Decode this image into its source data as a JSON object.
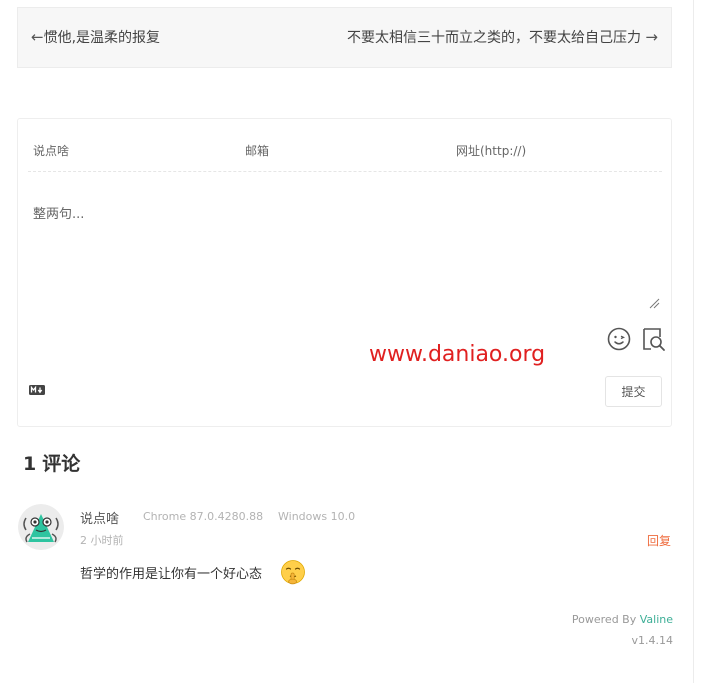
{
  "post_nav": {
    "prev_arrow": "←",
    "prev_title": "惯他,是温柔的报复",
    "next_title": "不要太相信三十而立之类的，不要太给自己压力",
    "next_arrow": "→"
  },
  "form": {
    "nick_placeholder": "说点啥",
    "mail_placeholder": "邮箱",
    "link_placeholder": "网址(http://)",
    "editor_placeholder": "整两句...",
    "submit_label": "提交",
    "icons": [
      "emoji-icon",
      "preview-icon",
      "markdown-icon",
      "resize-grip-icon"
    ]
  },
  "watermark": "www.daniao.org",
  "comments_header": {
    "count": "1",
    "label": "评论"
  },
  "comments": [
    {
      "nick": "说点啥",
      "browser": "Chrome 87.0.4280.88",
      "os": "Windows 10.0",
      "time": "2 小时前",
      "reply_label": "回复",
      "content": "哲学的作用是让你有一个好心态",
      "emoji": "shushing-face-emoji"
    }
  ],
  "footer": {
    "powered_prefix": "Powered By ",
    "powered_brand": "Valine",
    "version": "v1.4.14"
  },
  "colors": {
    "reply": "#ef6c3e",
    "brand": "#3eaf97",
    "watermark": "#e02020"
  }
}
